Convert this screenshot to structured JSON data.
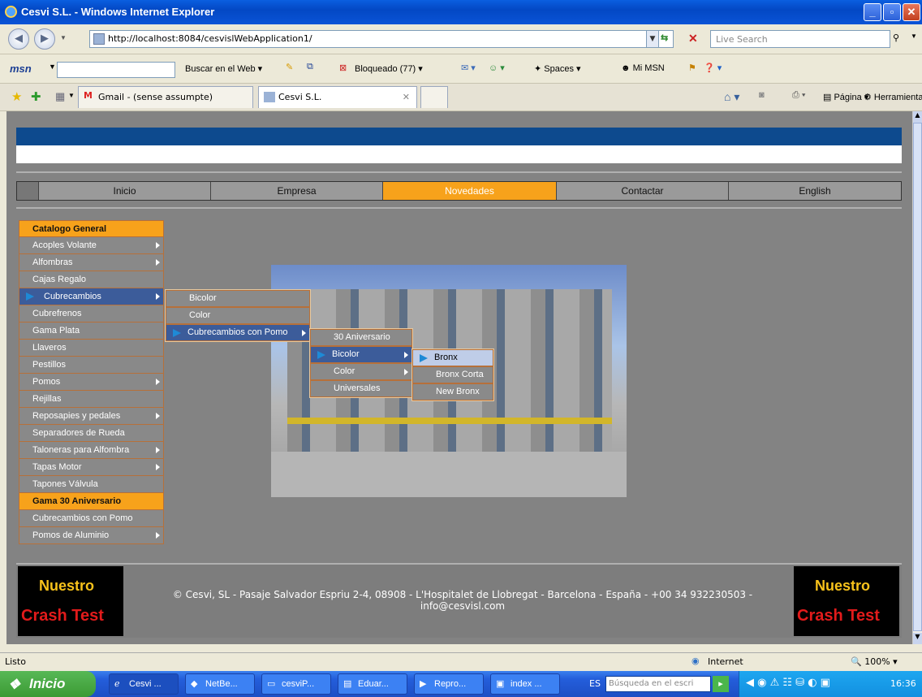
{
  "window": {
    "title": "Cesvi S.L. - Windows Internet Explorer"
  },
  "addressbar": {
    "url": "http://localhost:8084/cesvislWebApplication1/",
    "search_placeholder": "Live Search"
  },
  "msnbar": {
    "search_label": "Buscar en el Web",
    "blocked": "Bloqueado (77)",
    "spaces": "Spaces",
    "mymsn": "Mi MSN"
  },
  "tabs": [
    {
      "label": "Gmail - (sense assumpte)"
    },
    {
      "label": "Cesvi S.L."
    }
  ],
  "toolbar": {
    "page": "Página",
    "tools": "Herramientas"
  },
  "menu": [
    "Inicio",
    "Empresa",
    "Novedades",
    "Contactar",
    "English"
  ],
  "sidebar": [
    {
      "label": "Catalogo General",
      "type": "header"
    },
    {
      "label": "Acoples Volante"
    },
    {
      "label": "Alfombras"
    },
    {
      "label": "Cajas Regalo"
    },
    {
      "label": "Cubrecambios",
      "active": true
    },
    {
      "label": "Cubrefrenos"
    },
    {
      "label": "Gama Plata"
    },
    {
      "label": "Llaveros"
    },
    {
      "label": "Pestillos"
    },
    {
      "label": "Pomos"
    },
    {
      "label": "Rejillas"
    },
    {
      "label": "Reposapies y pedales"
    },
    {
      "label": "Separadores de Rueda"
    },
    {
      "label": "Taloneras para Alfombra"
    },
    {
      "label": "Tapas Motor"
    },
    {
      "label": "Tapones Válvula"
    },
    {
      "label": "Gama 30 Aniversario",
      "type": "header"
    },
    {
      "label": "Cubrecambios con Pomo"
    },
    {
      "label": "Pomos de Aluminio"
    }
  ],
  "submenu1": [
    "Bicolor",
    "Color",
    "Cubrecambios con Pomo"
  ],
  "submenu2": [
    "30 Aniversario",
    "Bicolor",
    "Color",
    "Universales"
  ],
  "submenu3": [
    "Bronx",
    "Bronx Corta",
    "New Bronx"
  ],
  "footer": {
    "crash_a": "Nuestro",
    "crash_b": "Crash Test",
    "text": "© Cesvi, SL - Pasaje Salvador Espriu 2-4, 08908 - L'Hospitalet de Llobregat - Barcelona - España - +00 34 932230503 - info@cesvisl.com"
  },
  "status": {
    "left": "Listo",
    "zone": "Internet",
    "zoom": "100%"
  },
  "taskbar": {
    "start": "Inicio",
    "items": [
      "Cesvi ...",
      "NetBe...",
      "cesviP...",
      "Eduar...",
      "Repro...",
      "index ..."
    ],
    "lang": "ES",
    "search_placeholder": "Búsqueda en el escri",
    "clock": "16:36"
  }
}
